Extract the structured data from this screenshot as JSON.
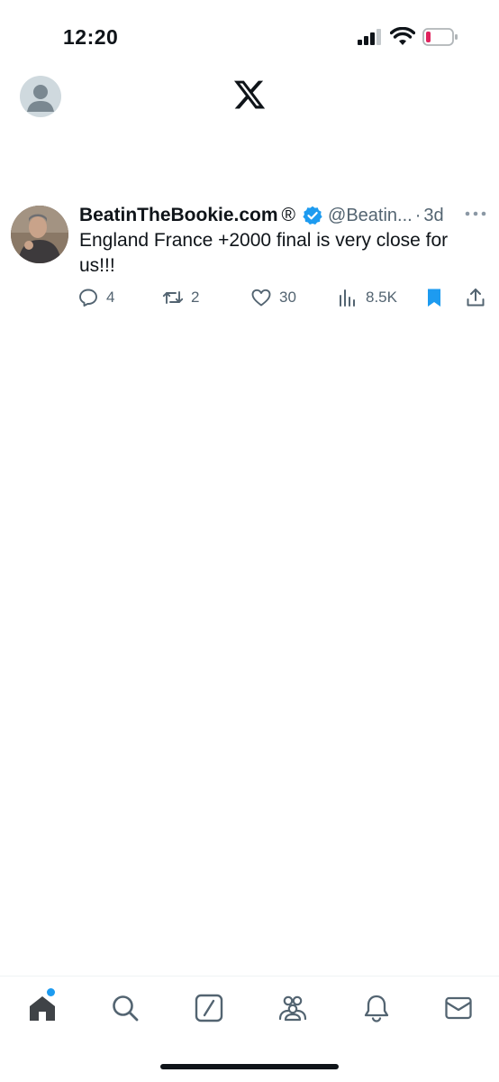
{
  "status_bar": {
    "time": "12:20"
  },
  "header": {
    "logo_icon": "x-logo-icon",
    "avatar_icon": "default-avatar-icon"
  },
  "tweet": {
    "display_name": "BeatinTheBookie.com",
    "registered_mark": "®",
    "handle": "@Beatin...",
    "separator": "·",
    "time_ago": "3d",
    "text": "England France +2000 final is very close for us!!!",
    "actions": {
      "replies": "4",
      "retweets": "2",
      "likes": "30",
      "views": "8.5K"
    },
    "bookmarked": true
  },
  "bottom_nav": {
    "items": [
      "home",
      "search",
      "grok",
      "communities",
      "notifications",
      "messages"
    ],
    "active": "home"
  },
  "colors": {
    "accent": "#1d9bf0",
    "text_primary": "#0f1419",
    "text_secondary": "#536471",
    "battery_low": "#e0245e"
  }
}
